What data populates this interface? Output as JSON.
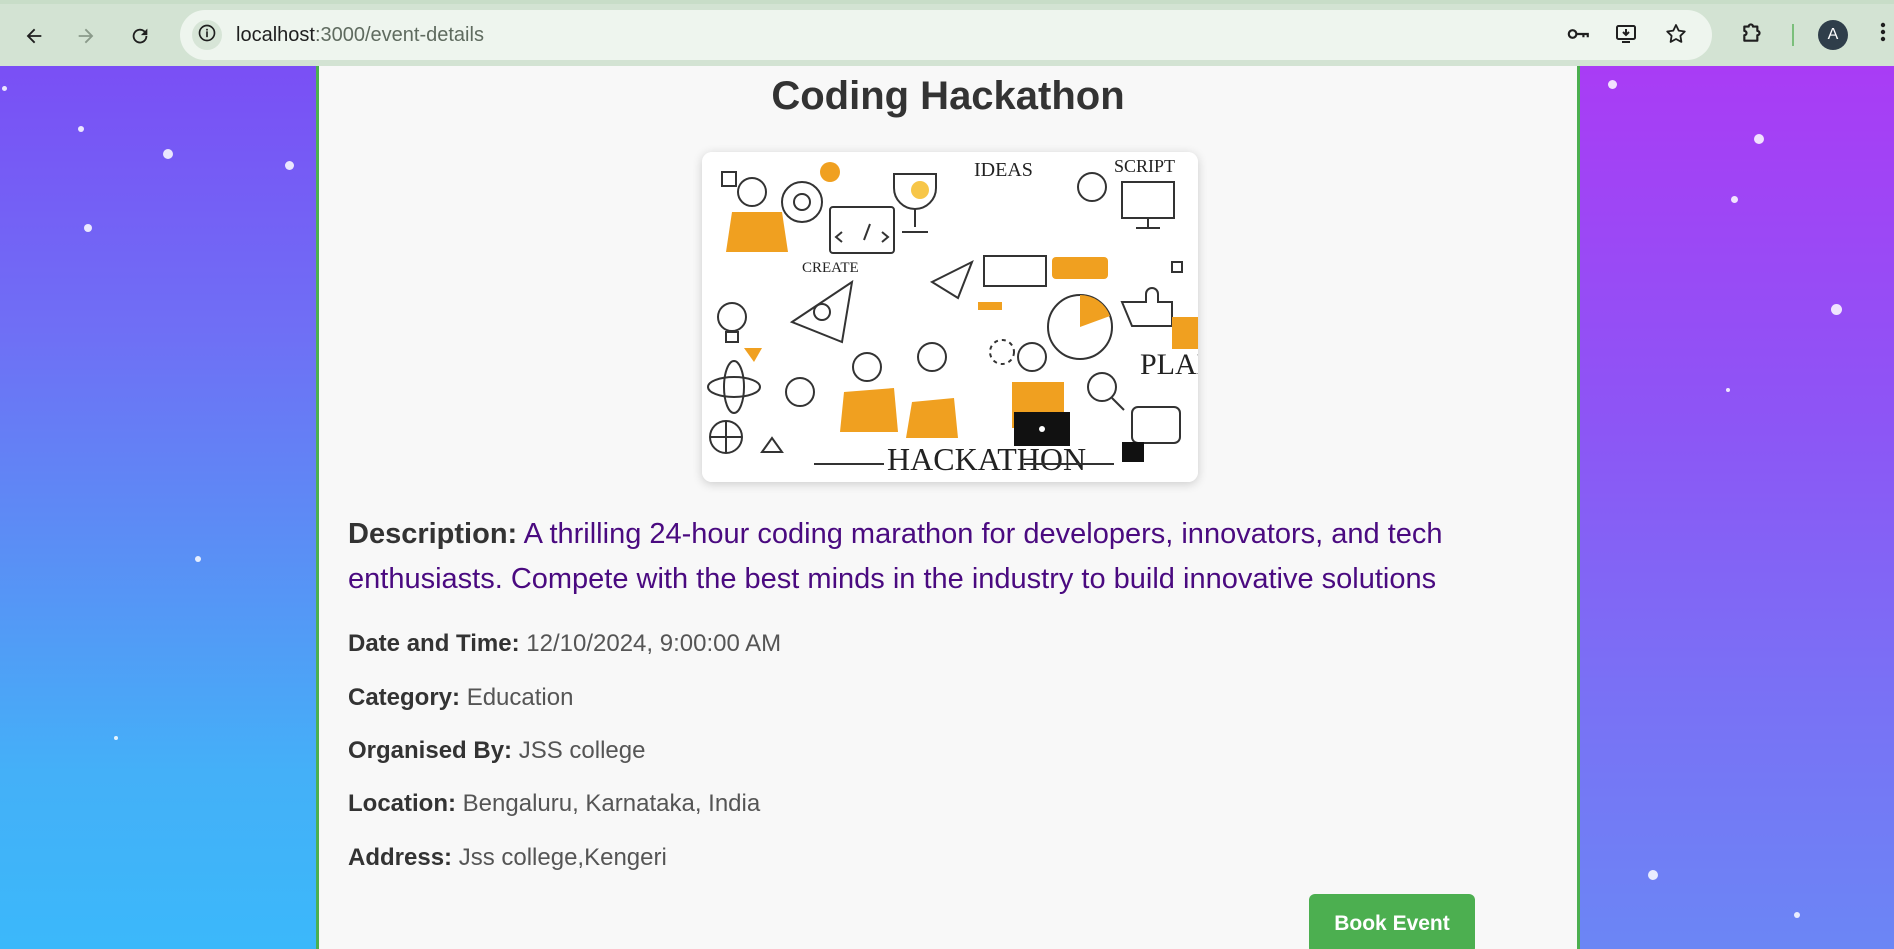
{
  "browser": {
    "url_host": "localhost",
    "url_path": ":3000/event-details",
    "profile_initial": "A",
    "icons": {
      "back": "arrow-left-icon",
      "forward": "arrow-right-icon",
      "reload": "reload-icon",
      "site_info": "info-icon",
      "password": "key-icon",
      "install": "install-app-icon",
      "bookmark": "star-icon",
      "extensions": "puzzle-icon",
      "menu": "kebab-menu-icon"
    }
  },
  "event": {
    "title": "Coding Hackathon",
    "image_alt": "Hackathon doodle illustration",
    "image_words": [
      "IDEAS",
      "SCRIPT",
      "CREATE",
      "PLAN",
      "HACKATHON"
    ],
    "description_label": "Description:",
    "description": "A thrilling 24-hour coding marathon for developers, innovators, and tech enthusiasts. Compete with the best minds in the industry to build innovative solutions",
    "details": [
      {
        "label": "Date and Time:",
        "value": "12/10/2024, 9:00:00 AM"
      },
      {
        "label": "Category:",
        "value": "Education"
      },
      {
        "label": "Organised By:",
        "value": "JSS college"
      },
      {
        "label": "Location:",
        "value": "Bengaluru, Karnataka, India"
      },
      {
        "label": "Address:",
        "value": "Jss college,Kengeri"
      }
    ],
    "book_label": "Book Event"
  },
  "colors": {
    "accent": "#4caf50",
    "description_text": "#4a0a80",
    "illustration_orange": "#f0a020"
  }
}
